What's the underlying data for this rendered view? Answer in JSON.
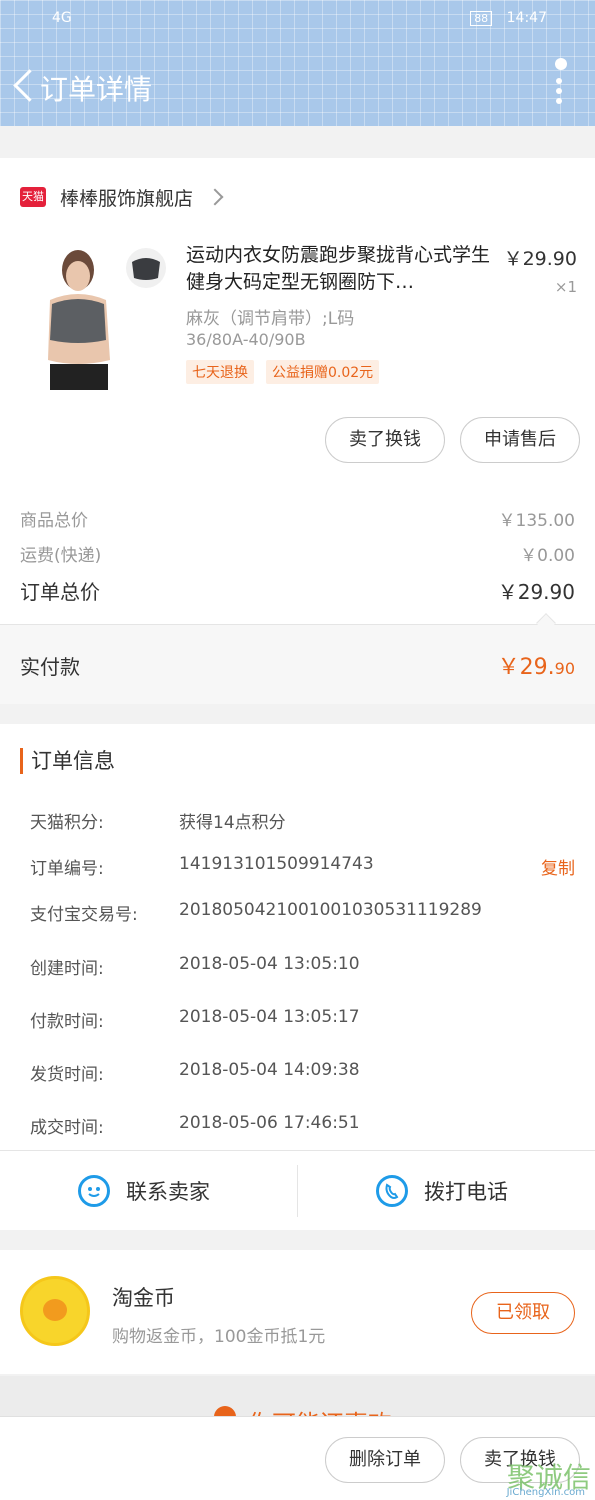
{
  "status_bar": {
    "signal": "4G",
    "battery": "88",
    "time": "14:47"
  },
  "header": {
    "title": "订单详情"
  },
  "shop": {
    "badge": "天猫",
    "name": "棒棒服饰旗舰店"
  },
  "product": {
    "title": "运动内衣女防震跑步聚拢背心式学生健身大码定型无钢圈防下…",
    "price": "￥29.90",
    "qty": "×1",
    "spec": "麻灰（调节肩带）;L码",
    "size": "36/80A-40/90B",
    "tags": [
      "七天退换",
      "公益捐赠0.02元"
    ]
  },
  "actions": {
    "sell": "卖了换钱",
    "after_sale": "申请售后"
  },
  "prices": {
    "goods_total_label": "商品总价",
    "goods_total": "￥135.00",
    "shipping_label": "运费(快递)",
    "shipping": "￥0.00",
    "order_total_label": "订单总价",
    "order_total": "￥29.90",
    "paid_label": "实付款",
    "paid_main": "￥29.",
    "paid_cents": "90"
  },
  "order_info": {
    "heading": "订单信息",
    "rows": [
      {
        "label": "天猫积分:",
        "value": "获得14点积分"
      },
      {
        "label": "订单编号:",
        "value": "141913101509914743",
        "action": "复制"
      },
      {
        "label": "支付宝交易号:",
        "value": "2018050421001001030531119289"
      },
      {
        "label": "创建时间:",
        "value": "2018-05-04 13:05:10"
      },
      {
        "label": "付款时间:",
        "value": "2018-05-04 13:05:17"
      },
      {
        "label": "发货时间:",
        "value": "2018-05-04 14:09:38"
      },
      {
        "label": "成交时间:",
        "value": "2018-05-06 17:46:51"
      }
    ]
  },
  "contact": {
    "seller": "联系卖家",
    "call": "拨打电话"
  },
  "coins": {
    "title": "淘金币",
    "subtitle": "购物返金币，100金币抵1元",
    "button": "已领取"
  },
  "guess": {
    "text": "你可能还喜欢"
  },
  "bottom": {
    "delete": "删除订单",
    "sell": "卖了换钱"
  },
  "watermark": {
    "text": "聚诚信",
    "url": "JiChengXin.com"
  },
  "colors": {
    "accent": "#e8641b",
    "tmall": "#e4213b",
    "contact_icon": "#1e9be8"
  }
}
